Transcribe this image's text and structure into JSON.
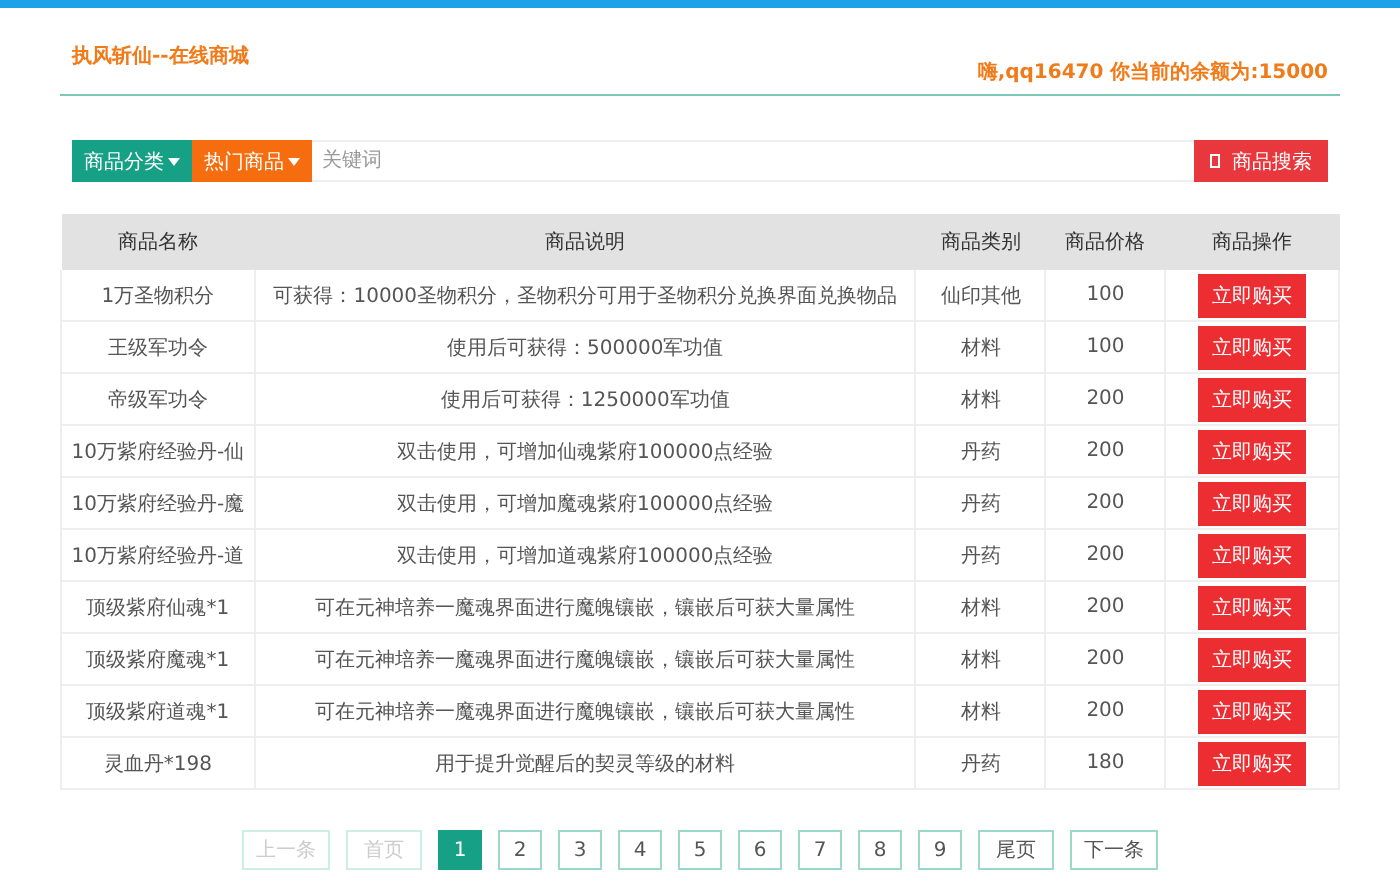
{
  "header": {
    "title": "执风斩仙--在线商城",
    "balance": "嗨,qq16470 你当前的余额为:15000"
  },
  "search": {
    "category_button": "商品分类",
    "hot_button": "热门商品",
    "placeholder": "关键词",
    "search_button": "商品搜索"
  },
  "table": {
    "columns": [
      "商品名称",
      "商品说明",
      "商品类别",
      "商品价格",
      "商品操作"
    ],
    "rows": [
      {
        "name": "1万圣物积分",
        "description": "可获得：10000圣物积分，圣物积分可用于圣物积分兑换界面兑换物品",
        "category": "仙印其他",
        "price": "100",
        "action": "立即购买"
      },
      {
        "name": "王级军功令",
        "description": "使用后可获得：500000军功值",
        "category": "材料",
        "price": "100",
        "action": "立即购买"
      },
      {
        "name": "帝级军功令",
        "description": "使用后可获得：1250000军功值",
        "category": "材料",
        "price": "200",
        "action": "立即购买"
      },
      {
        "name": "10万紫府经验丹-仙",
        "description": "双击使用，可增加仙魂紫府100000点经验",
        "category": "丹药",
        "price": "200",
        "action": "立即购买"
      },
      {
        "name": "10万紫府经验丹-魔",
        "description": "双击使用，可增加魔魂紫府100000点经验",
        "category": "丹药",
        "price": "200",
        "action": "立即购买"
      },
      {
        "name": "10万紫府经验丹-道",
        "description": "双击使用，可增加道魂紫府100000点经验",
        "category": "丹药",
        "price": "200",
        "action": "立即购买"
      },
      {
        "name": "顶级紫府仙魂*1",
        "description": "可在元神培养一魔魂界面进行魔魄镶嵌，镶嵌后可获大量属性",
        "category": "材料",
        "price": "200",
        "action": "立即购买"
      },
      {
        "name": "顶级紫府魔魂*1",
        "description": "可在元神培养一魔魂界面进行魔魄镶嵌，镶嵌后可获大量属性",
        "category": "材料",
        "price": "200",
        "action": "立即购买"
      },
      {
        "name": "顶级紫府道魂*1",
        "description": "可在元神培养一魔魂界面进行魔魄镶嵌，镶嵌后可获大量属性",
        "category": "材料",
        "price": "200",
        "action": "立即购买"
      },
      {
        "name": "灵血丹*198",
        "description": "用于提升觉醒后的契灵等级的材料",
        "category": "丹药",
        "price": "180",
        "action": "立即购买"
      }
    ]
  },
  "pagination": [
    {
      "label": "上一条",
      "selected": false,
      "disabled": true
    },
    {
      "label": "首页",
      "selected": false,
      "disabled": true
    },
    {
      "label": "1",
      "selected": true,
      "disabled": false
    },
    {
      "label": "2",
      "selected": false,
      "disabled": false
    },
    {
      "label": "3",
      "selected": false,
      "disabled": false
    },
    {
      "label": "4",
      "selected": false,
      "disabled": false
    },
    {
      "label": "5",
      "selected": false,
      "disabled": false
    },
    {
      "label": "6",
      "selected": false,
      "disabled": false
    },
    {
      "label": "7",
      "selected": false,
      "disabled": false
    },
    {
      "label": "8",
      "selected": false,
      "disabled": false
    },
    {
      "label": "9",
      "selected": false,
      "disabled": false
    },
    {
      "label": "尾页",
      "selected": false,
      "disabled": false
    },
    {
      "label": "下一条",
      "selected": false,
      "disabled": false
    }
  ]
}
